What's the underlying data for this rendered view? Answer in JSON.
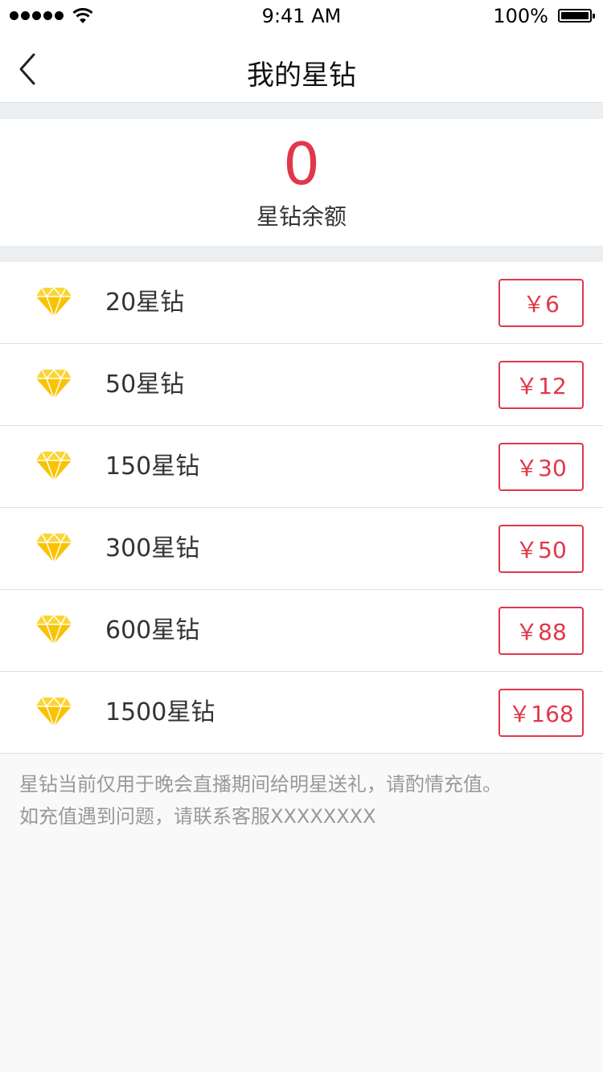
{
  "status_bar": {
    "time": "9:41 AM",
    "battery": "100%"
  },
  "nav": {
    "title": "我的星钻"
  },
  "balance": {
    "value": "0",
    "label": "星钻余额"
  },
  "packages": [
    {
      "label": "20星钻",
      "price": "￥6"
    },
    {
      "label": "50星钻",
      "price": "￥12"
    },
    {
      "label": "150星钻",
      "price": "￥30"
    },
    {
      "label": "300星钻",
      "price": "￥50"
    },
    {
      "label": "600星钻",
      "price": "￥88"
    },
    {
      "label": "1500星钻",
      "price": "￥168"
    }
  ],
  "notes": [
    "星钻当前仅用于晚会直播期间给明星送礼，请酌情充值。",
    "如充值遇到问题，请联系客服XXXXXXXX"
  ],
  "colors": {
    "accent": "#e0384a",
    "diamond": "#f9c300"
  },
  "icons": {
    "back": "chevron-left-icon",
    "package": "diamond-icon"
  }
}
